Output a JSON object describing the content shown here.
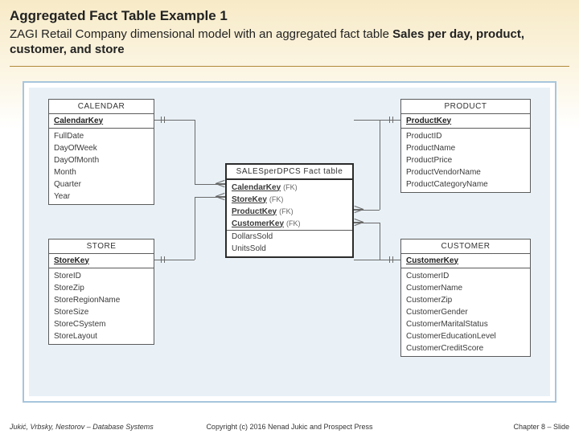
{
  "slide": {
    "title": "Aggregated Fact Table Example 1",
    "subtitle_plain": "ZAGI Retail Company dimensional model with an aggregated fact table ",
    "subtitle_bold": "Sales per day, product, customer, and store"
  },
  "entities": {
    "calendar": {
      "name": "CALENDAR",
      "key": "CalendarKey",
      "attrs": [
        "FullDate",
        "DayOfWeek",
        "DayOfMonth",
        "Month",
        "Quarter",
        "Year"
      ]
    },
    "product": {
      "name": "PRODUCT",
      "key": "ProductKey",
      "attrs": [
        "ProductID",
        "ProductName",
        "ProductPrice",
        "ProductVendorName",
        "ProductCategoryName"
      ]
    },
    "store": {
      "name": "STORE",
      "key": "StoreKey",
      "attrs": [
        "StoreID",
        "StoreZip",
        "StoreRegionName",
        "StoreSize",
        "StoreCSystem",
        "StoreLayout"
      ]
    },
    "customer": {
      "name": "CUSTOMER",
      "key": "CustomerKey",
      "attrs": [
        "CustomerID",
        "CustomerName",
        "CustomerZip",
        "CustomerGender",
        "CustomerMaritalStatus",
        "CustomerEducationLevel",
        "CustomerCreditScore"
      ]
    },
    "fact": {
      "name": "SALESperDPCS Fact table",
      "keys": [
        "CalendarKey",
        "StoreKey",
        "ProductKey",
        "CustomerKey"
      ],
      "fk_label": "(FK)",
      "measures": [
        "DollarsSold",
        "UnitsSold"
      ]
    }
  },
  "footer": {
    "left": "Jukić, Vrbsky, Nestorov – Database Systems",
    "center": "Copyright (c) 2016 Nenad Jukic and Prospect Press",
    "right": "Chapter 8 – Slide"
  }
}
